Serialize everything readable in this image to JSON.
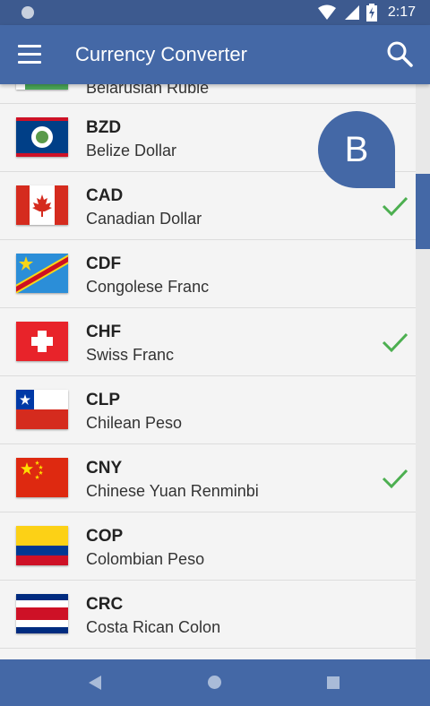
{
  "status_bar": {
    "time": "2:17"
  },
  "app_bar": {
    "title": "Currency Converter"
  },
  "fast_scroll": {
    "letter": "B"
  },
  "partial_row": {
    "name": "Belarusian Ruble"
  },
  "currencies": [
    {
      "code": "BZD",
      "name": "Belize Dollar",
      "selected": false,
      "flag": "belize-flag"
    },
    {
      "code": "CAD",
      "name": "Canadian Dollar",
      "selected": true,
      "flag": "canada-flag"
    },
    {
      "code": "CDF",
      "name": "Congolese Franc",
      "selected": false,
      "flag": "congo-flag"
    },
    {
      "code": "CHF",
      "name": "Swiss Franc",
      "selected": true,
      "flag": "switzerland-flag"
    },
    {
      "code": "CLP",
      "name": "Chilean Peso",
      "selected": false,
      "flag": "chile-flag"
    },
    {
      "code": "CNY",
      "name": "Chinese Yuan Renminbi",
      "selected": true,
      "flag": "china-flag"
    },
    {
      "code": "COP",
      "name": "Colombian Peso",
      "selected": false,
      "flag": "colombia-flag"
    },
    {
      "code": "CRC",
      "name": "Costa Rican Colon",
      "selected": false,
      "flag": "costa-rica-flag"
    }
  ],
  "colors": {
    "primary": "#4468a6",
    "status_bar": "#3d5a8f",
    "check": "#4caf50"
  }
}
